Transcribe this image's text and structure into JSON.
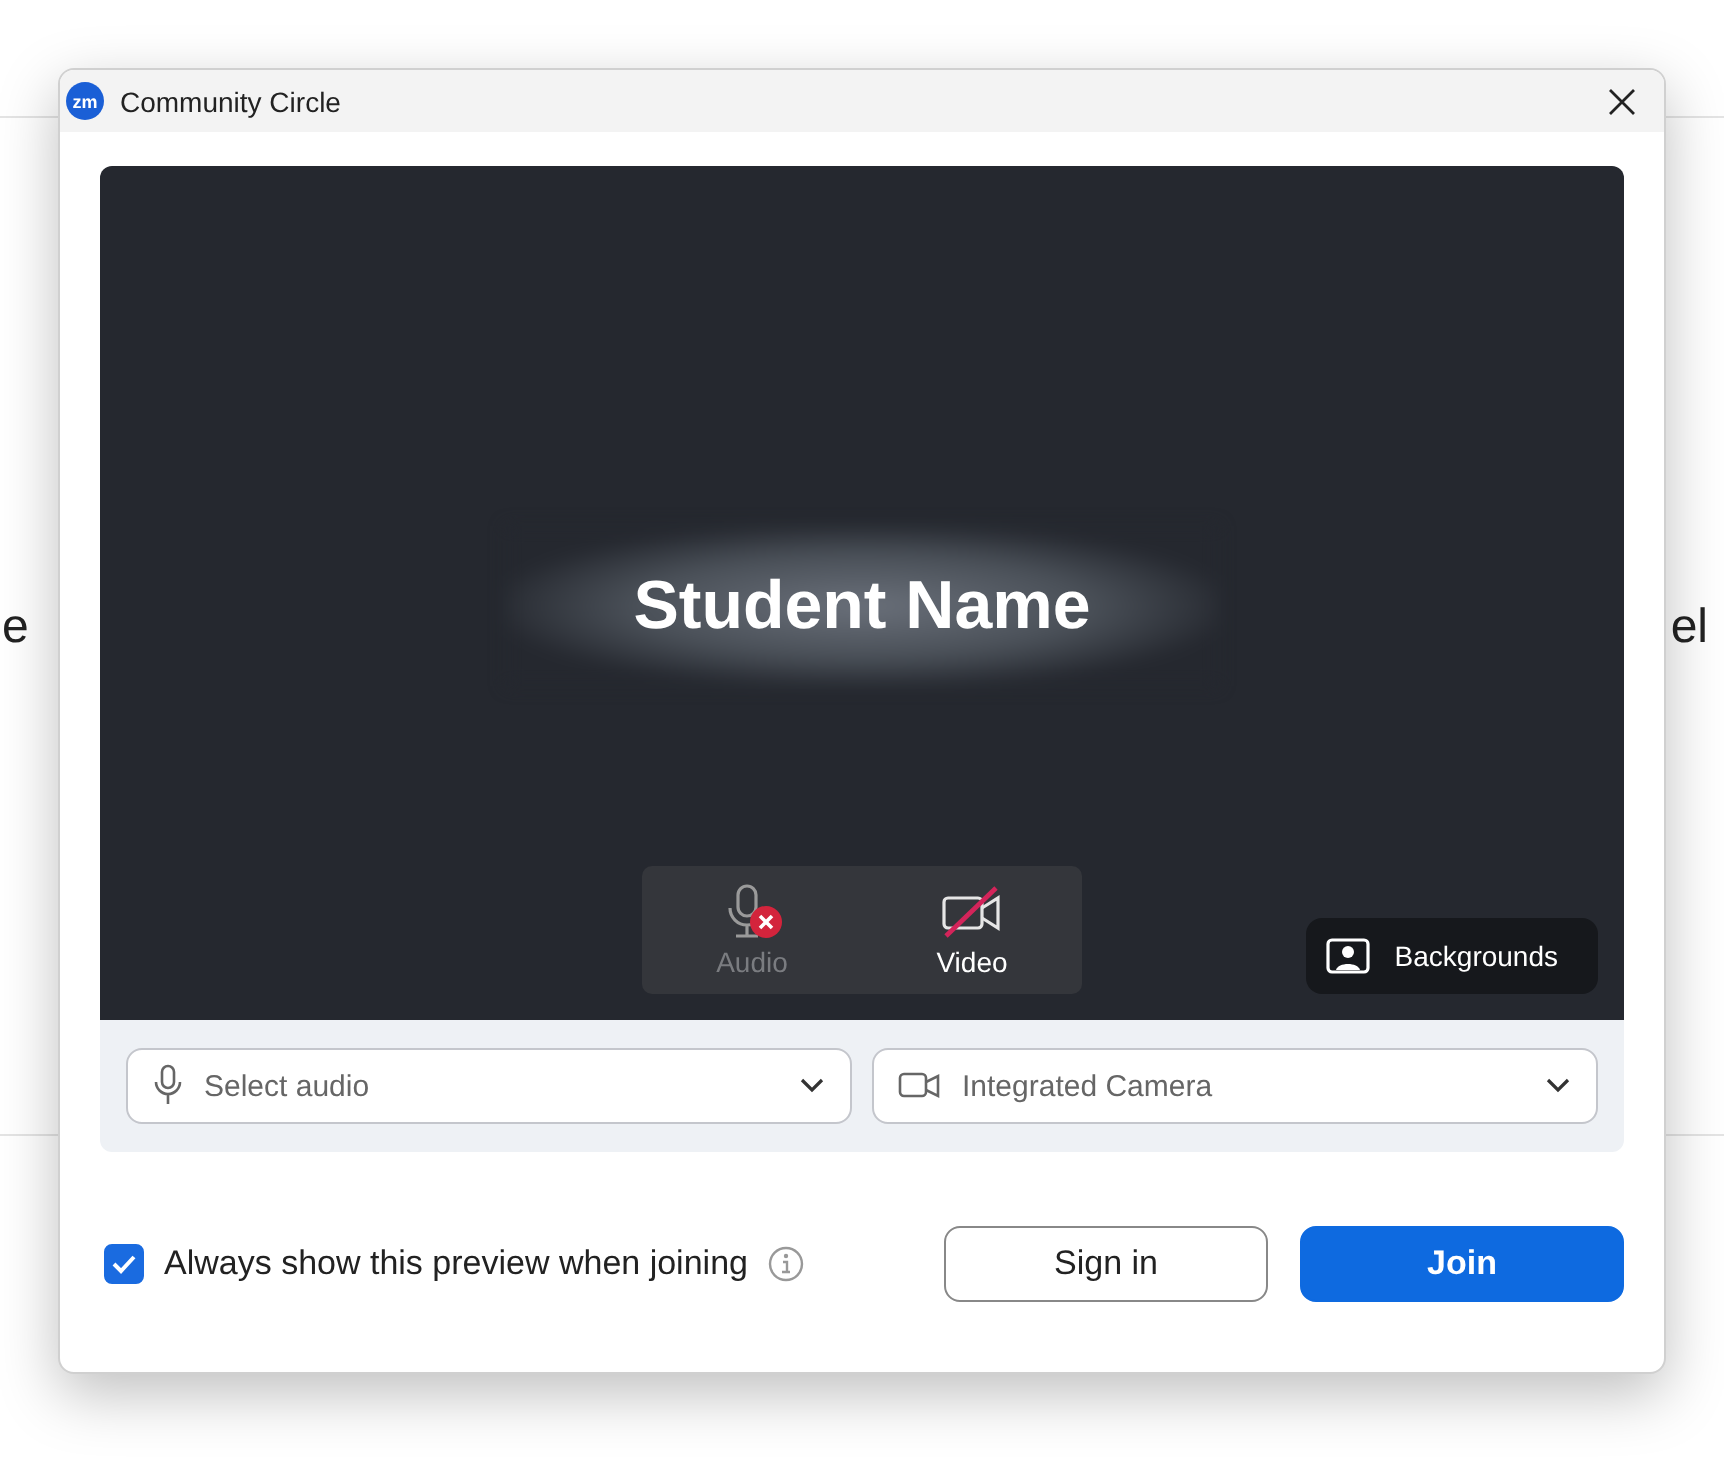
{
  "background_page": {
    "left_text": "e",
    "right_text": "el"
  },
  "window": {
    "title": "Community Circle",
    "app_badge": "zm"
  },
  "preview": {
    "name_label": "Student Name",
    "controls": [
      {
        "kind": "audio",
        "label": "Audio",
        "off": true
      },
      {
        "kind": "video",
        "label": "Video",
        "off": true
      }
    ],
    "backgrounds_button": "Backgrounds"
  },
  "devices": [
    {
      "kind": "audio",
      "value": "Select audio"
    },
    {
      "kind": "camera",
      "value": "Integrated Camera"
    }
  ],
  "always_show_preview": {
    "label": "Always show this preview when joining",
    "checked": true
  },
  "buttons": [
    {
      "kind": "secondary",
      "label": "Sign in"
    },
    {
      "kind": "primary",
      "label": "Join"
    }
  ]
}
